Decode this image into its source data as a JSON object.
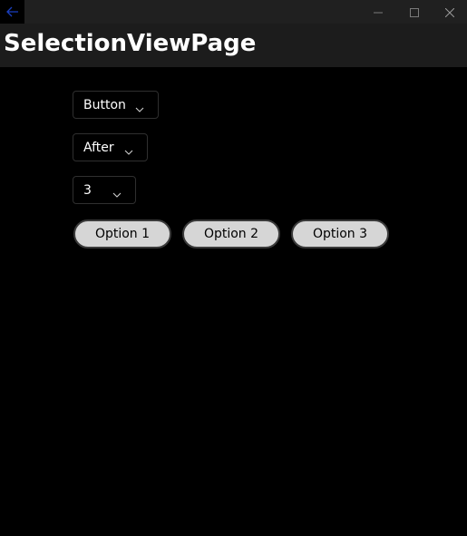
{
  "titlebar": {
    "back_icon": "arrow-left-icon",
    "minimize_icon": "minimize-icon",
    "maximize_icon": "maximize-icon",
    "close_icon": "close-icon",
    "back_color": "#1a3fbf"
  },
  "header": {
    "title": "SelectionViewPage"
  },
  "combos": [
    {
      "value": "Button",
      "icon": "chevron-down-icon"
    },
    {
      "value": "After",
      "icon": "chevron-down-icon"
    },
    {
      "value": "3",
      "icon": "chevron-down-icon"
    }
  ],
  "options": [
    {
      "label": "Option 1"
    },
    {
      "label": "Option 2"
    },
    {
      "label": "Option 3"
    }
  ],
  "colors": {
    "background": "#000000",
    "header": "#1c1c1c",
    "option_fill": "#d6d6d6"
  }
}
